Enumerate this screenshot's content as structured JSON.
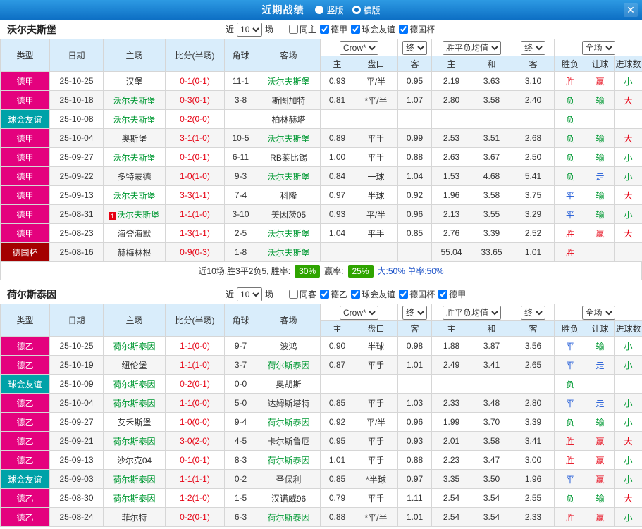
{
  "colors": {
    "competition": {
      "德甲": "#e4017e",
      "德乙": "#e4017e",
      "球会友谊": "#00a2a8",
      "德国杯": "#a40000"
    },
    "result": {
      "胜": "#e60012",
      "平": "#1a56d6",
      "负": "#009933",
      "赢": "#e60012",
      "走": "#1a56d6",
      "输": "#009933",
      "大": "#e60012",
      "小": "#009933"
    },
    "focus_team": "#009933",
    "score": "#e60012",
    "badge": "#2fa400",
    "topbar": "#1581d6"
  },
  "topbar": {
    "title": "近期战绩",
    "radios": [
      {
        "label": "竖版",
        "selected": false
      },
      {
        "label": "横版",
        "selected": true
      }
    ],
    "close_icon": "✕"
  },
  "table": {
    "headers": [
      "类型",
      "日期",
      "主场",
      "比分(半场)",
      "角球",
      "客场",
      "主",
      "盘口",
      "客",
      "主",
      "和",
      "客",
      "胜负",
      "让球",
      "进球数"
    ],
    "selects": [
      "Crow*",
      "终",
      "胜平负均值",
      "终",
      "全场"
    ]
  },
  "sections": [
    {
      "team": "沃尔夫斯堡",
      "filter": {
        "near": "近",
        "count": "10",
        "unit": "场",
        "checkboxes": [
          {
            "label": "同主",
            "checked": false
          },
          {
            "label": "德甲",
            "checked": true
          },
          {
            "label": "球会友谊",
            "checked": true
          },
          {
            "label": "德国杯",
            "checked": true
          }
        ]
      },
      "rows": [
        {
          "type": "德甲",
          "date": "25-10-25",
          "home": "汉堡",
          "score": "0-1(0-1)",
          "corner": "11-1",
          "away": "沃尔夫斯堡",
          "ah": "0.93",
          "handicap": "平/半",
          "aa": "0.95",
          "eh": "2.19",
          "ed": "3.63",
          "ea": "3.10",
          "res": "胜",
          "hres": "赢",
          "goals": "小"
        },
        {
          "type": "德甲",
          "date": "25-10-18",
          "home": "沃尔夫斯堡",
          "score": "0-3(0-1)",
          "corner": "3-8",
          "away": "斯图加特",
          "ah": "0.81",
          "handicap": "*平/半",
          "aa": "1.07",
          "eh": "2.80",
          "ed": "3.58",
          "ea": "2.40",
          "res": "负",
          "hres": "输",
          "goals": "大"
        },
        {
          "type": "球会友谊",
          "date": "25-10-08",
          "home": "沃尔夫斯堡",
          "score": "0-2(0-0)",
          "corner": "",
          "away": "柏林赫塔",
          "ah": "",
          "handicap": "",
          "aa": "",
          "eh": "",
          "ed": "",
          "ea": "",
          "res": "负",
          "hres": "",
          "goals": ""
        },
        {
          "type": "德甲",
          "date": "25-10-04",
          "home": "奥斯堡",
          "score": "3-1(1-0)",
          "corner": "10-5",
          "away": "沃尔夫斯堡",
          "ah": "0.89",
          "handicap": "平手",
          "aa": "0.99",
          "eh": "2.53",
          "ed": "3.51",
          "ea": "2.68",
          "res": "负",
          "hres": "输",
          "goals": "大"
        },
        {
          "type": "德甲",
          "date": "25-09-27",
          "home": "沃尔夫斯堡",
          "score": "0-1(0-1)",
          "corner": "6-11",
          "away": "RB莱比锡",
          "ah": "1.00",
          "handicap": "平手",
          "aa": "0.88",
          "eh": "2.63",
          "ed": "3.67",
          "ea": "2.50",
          "res": "负",
          "hres": "输",
          "goals": "小"
        },
        {
          "type": "德甲",
          "date": "25-09-22",
          "home": "多特蒙德",
          "score": "1-0(1-0)",
          "corner": "9-3",
          "away": "沃尔夫斯堡",
          "ah": "0.84",
          "handicap": "一球",
          "aa": "1.04",
          "eh": "1.53",
          "ed": "4.68",
          "ea": "5.41",
          "res": "负",
          "hres": "走",
          "goals": "小"
        },
        {
          "type": "德甲",
          "date": "25-09-13",
          "home": "沃尔夫斯堡",
          "score": "3-3(1-1)",
          "corner": "7-4",
          "away": "科隆",
          "ah": "0.97",
          "handicap": "半球",
          "aa": "0.92",
          "eh": "1.96",
          "ed": "3.58",
          "ea": "3.75",
          "res": "平",
          "hres": "输",
          "goals": "大"
        },
        {
          "type": "德甲",
          "date": "25-08-31",
          "home": "沃尔夫斯堡",
          "home_card": "1",
          "score": "1-1(1-0)",
          "corner": "3-10",
          "away": "美因茨05",
          "ah": "0.93",
          "handicap": "平/半",
          "aa": "0.96",
          "eh": "2.13",
          "ed": "3.55",
          "ea": "3.29",
          "res": "平",
          "hres": "输",
          "goals": "小"
        },
        {
          "type": "德甲",
          "date": "25-08-23",
          "home": "海登海默",
          "score": "1-3(1-1)",
          "corner": "2-5",
          "away": "沃尔夫斯堡",
          "ah": "1.04",
          "handicap": "平手",
          "aa": "0.85",
          "eh": "2.76",
          "ed": "3.39",
          "ea": "2.52",
          "res": "胜",
          "hres": "赢",
          "goals": "大"
        },
        {
          "type": "德国杯",
          "date": "25-08-16",
          "home": "赫梅林根",
          "score": "0-9(0-3)",
          "corner": "1-8",
          "away": "沃尔夫斯堡",
          "ah": "",
          "handicap": "",
          "aa": "",
          "eh": "55.04",
          "ed": "33.65",
          "ea": "1.01",
          "res": "胜",
          "hres": "",
          "goals": ""
        }
      ],
      "summary": {
        "prefix": "近10场,胜3平2负5, 胜率:",
        "win_rate": "30%",
        "mid": "赢率:",
        "handicap_rate": "25%",
        "suffix": "大:50% 单率:50%"
      }
    },
    {
      "team": "荷尔斯泰因",
      "filter": {
        "near": "近",
        "count": "10",
        "unit": "场",
        "checkboxes": [
          {
            "label": "同客",
            "checked": false
          },
          {
            "label": "德乙",
            "checked": true
          },
          {
            "label": "球会友谊",
            "checked": true
          },
          {
            "label": "德国杯",
            "checked": true
          },
          {
            "label": "德甲",
            "checked": true
          }
        ]
      },
      "rows": [
        {
          "type": "德乙",
          "date": "25-10-25",
          "home": "荷尔斯泰因",
          "score": "1-1(0-0)",
          "corner": "9-7",
          "away": "波鸿",
          "ah": "0.90",
          "handicap": "半球",
          "aa": "0.98",
          "eh": "1.88",
          "ed": "3.87",
          "ea": "3.56",
          "res": "平",
          "hres": "输",
          "goals": "小"
        },
        {
          "type": "德乙",
          "date": "25-10-19",
          "home": "纽伦堡",
          "score": "1-1(1-0)",
          "corner": "3-7",
          "away": "荷尔斯泰因",
          "ah": "0.87",
          "handicap": "平手",
          "aa": "1.01",
          "eh": "2.49",
          "ed": "3.41",
          "ea": "2.65",
          "res": "平",
          "hres": "走",
          "goals": "小"
        },
        {
          "type": "球会友谊",
          "date": "25-10-09",
          "home": "荷尔斯泰因",
          "score": "0-2(0-1)",
          "corner": "0-0",
          "away": "奥胡斯",
          "ah": "",
          "handicap": "",
          "aa": "",
          "eh": "",
          "ed": "",
          "ea": "",
          "res": "负",
          "hres": "",
          "goals": ""
        },
        {
          "type": "德乙",
          "date": "25-10-04",
          "home": "荷尔斯泰因",
          "score": "1-1(0-0)",
          "corner": "5-0",
          "away": "达姆斯塔特",
          "ah": "0.85",
          "handicap": "平手",
          "aa": "1.03",
          "eh": "2.33",
          "ed": "3.48",
          "ea": "2.80",
          "res": "平",
          "hres": "走",
          "goals": "小"
        },
        {
          "type": "德乙",
          "date": "25-09-27",
          "home": "艾禾斯堡",
          "score": "1-0(0-0)",
          "corner": "9-4",
          "away": "荷尔斯泰因",
          "ah": "0.92",
          "handicap": "平/半",
          "aa": "0.96",
          "eh": "1.99",
          "ed": "3.70",
          "ea": "3.39",
          "res": "负",
          "hres": "输",
          "goals": "小"
        },
        {
          "type": "德乙",
          "date": "25-09-21",
          "home": "荷尔斯泰因",
          "score": "3-0(2-0)",
          "corner": "4-5",
          "away": "卡尔斯鲁厄",
          "ah": "0.95",
          "handicap": "平手",
          "aa": "0.93",
          "eh": "2.01",
          "ed": "3.58",
          "ea": "3.41",
          "res": "胜",
          "hres": "赢",
          "goals": "大"
        },
        {
          "type": "德乙",
          "date": "25-09-13",
          "home": "沙尔克04",
          "score": "0-1(0-1)",
          "corner": "8-3",
          "away": "荷尔斯泰因",
          "ah": "1.01",
          "handicap": "平手",
          "aa": "0.88",
          "eh": "2.23",
          "ed": "3.47",
          "ea": "3.00",
          "res": "胜",
          "hres": "赢",
          "goals": "小"
        },
        {
          "type": "球会友谊",
          "date": "25-09-03",
          "home": "荷尔斯泰因",
          "score": "1-1(1-1)",
          "corner": "0-2",
          "away": "圣保利",
          "ah": "0.85",
          "handicap": "*半球",
          "aa": "0.97",
          "eh": "3.35",
          "ed": "3.50",
          "ea": "1.96",
          "res": "平",
          "hres": "赢",
          "goals": "小"
        },
        {
          "type": "德乙",
          "date": "25-08-30",
          "home": "荷尔斯泰因",
          "score": "1-2(1-0)",
          "corner": "1-5",
          "away": "汉诺威96",
          "ah": "0.79",
          "handicap": "平手",
          "aa": "1.11",
          "eh": "2.54",
          "ed": "3.54",
          "ea": "2.55",
          "res": "负",
          "hres": "输",
          "goals": "大"
        },
        {
          "type": "德乙",
          "date": "25-08-24",
          "home": "菲尔特",
          "score": "0-2(0-1)",
          "corner": "6-3",
          "away": "荷尔斯泰因",
          "ah": "0.88",
          "handicap": "*平/半",
          "aa": "1.01",
          "eh": "2.54",
          "ed": "3.54",
          "ea": "2.33",
          "res": "胜",
          "hres": "赢",
          "goals": "小"
        }
      ]
    }
  ]
}
